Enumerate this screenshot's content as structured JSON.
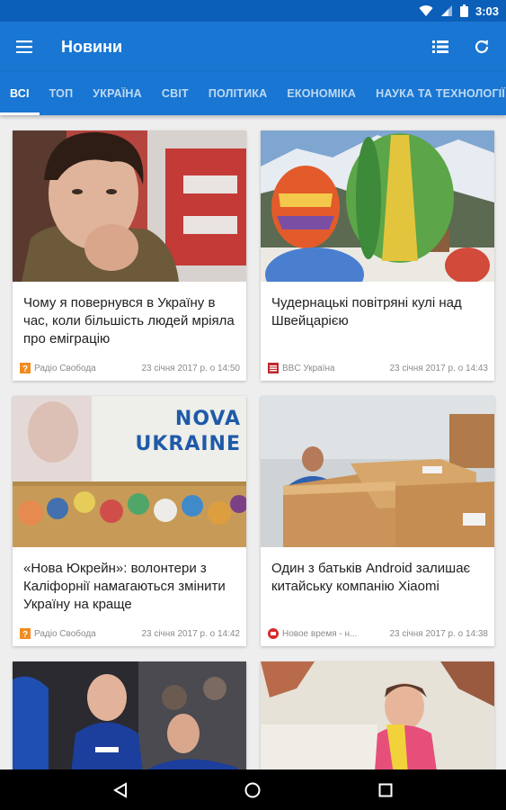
{
  "status_bar": {
    "time": "3:03"
  },
  "app_bar": {
    "title": "Новини"
  },
  "tabs": [
    {
      "label": "ВСІ",
      "active": true
    },
    {
      "label": "ТОП"
    },
    {
      "label": "УКРАЇНА"
    },
    {
      "label": "СВІТ"
    },
    {
      "label": "ПОЛІТИКА"
    },
    {
      "label": "ЕКОНОМІКА"
    },
    {
      "label": "НАУКА ТА ТЕХНОЛОГІЇ"
    }
  ],
  "articles": [
    {
      "title": "Чому я повернувся в Україну в час, коли більшість людей мріяла про еміграцію",
      "source": "Радіо Свобода",
      "date": "23 січня 2017 р. о 14:50",
      "source_color": "#f28b20"
    },
    {
      "title": "Чудернацькі повітряні кулі над Швейцарією",
      "source": "BBC Україна",
      "date": "23 січня 2017 р. о 14:43",
      "source_color": "#c0282d"
    },
    {
      "title": "«Нова Юкрейн»: волонтери з Каліфорнії намагаються змінити Україну на краще",
      "source": "Радіо Свобода",
      "date": "23 січня 2017 р. о 14:42",
      "source_color": "#f28b20",
      "image_text_1": "NOVA",
      "image_text_2": "UKRAINE"
    },
    {
      "title": "Один з батьків Android залишає китайську компанію Xiaomi",
      "source": "Новое время - н...",
      "date": "23 січня 2017 р. о 14:38",
      "source_color": "#d62b2b"
    },
    {
      "title": "",
      "source": "",
      "date": ""
    },
    {
      "title": "",
      "source": "",
      "date": ""
    }
  ],
  "colors": {
    "primary": "#1976d2",
    "status_bar": "#0c5fb8"
  }
}
